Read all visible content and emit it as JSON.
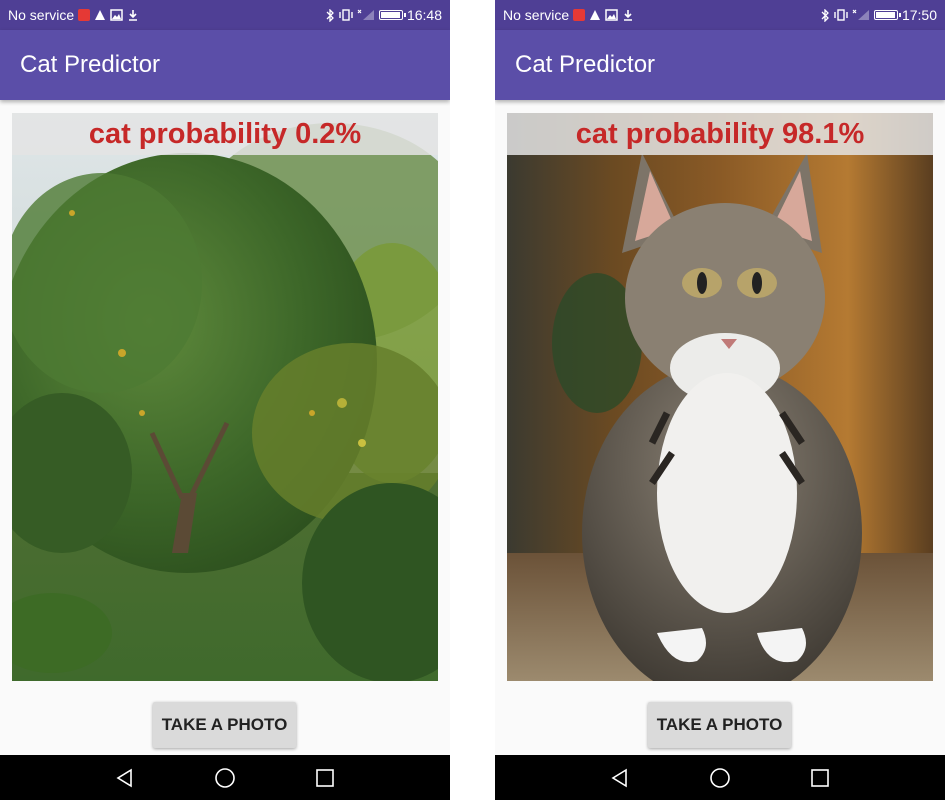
{
  "colors": {
    "statusbar": "#4f3f95",
    "appbar": "#5b4ea8",
    "probability_text": "#c62828",
    "button_bg": "#dadada",
    "navbar": "#000000"
  },
  "screens": [
    {
      "status": {
        "carrier": "No service",
        "icons": [
          "notification-icon",
          "warning-icon",
          "image-icon",
          "download-icon",
          "bluetooth-icon",
          "vibrate-icon",
          "no-signal-icon",
          "battery-icon"
        ],
        "battery_level": 0.9,
        "time": "16:48"
      },
      "app_title": "Cat Predictor",
      "result": "cat probability 0.2%",
      "photo": "tree-photo",
      "button": "TAKE A PHOTO",
      "nav": [
        "back-icon",
        "home-icon",
        "recents-icon"
      ]
    },
    {
      "status": {
        "carrier": "No service",
        "icons": [
          "notification-icon",
          "warning-icon",
          "image-icon",
          "download-icon",
          "bluetooth-icon",
          "vibrate-icon",
          "no-signal-icon",
          "battery-icon"
        ],
        "battery_level": 0.9,
        "time": "17:50"
      },
      "app_title": "Cat Predictor",
      "result": "cat probability 98.1%",
      "photo": "kitten-photo",
      "button": "TAKE A PHOTO",
      "nav": [
        "back-icon",
        "home-icon",
        "recents-icon"
      ]
    }
  ]
}
